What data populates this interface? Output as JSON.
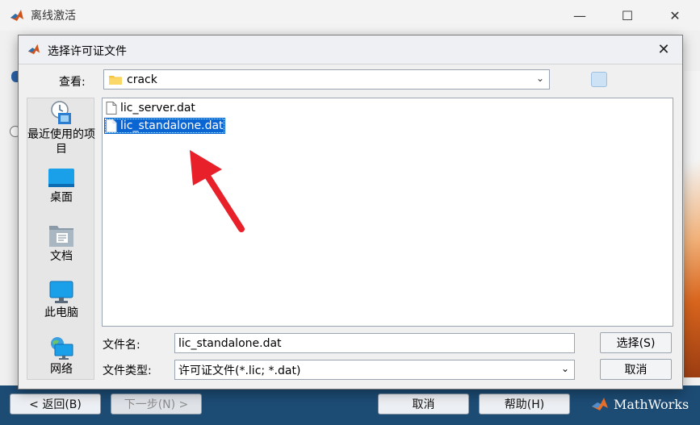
{
  "background_window": {
    "title": "离线激活",
    "controls": [
      "—",
      "☐",
      "✕"
    ],
    "footer": {
      "back_label": "< 返回(B)",
      "next_label": "下一步(N) >",
      "cancel_label": "取消",
      "help_label": "帮助(H)",
      "brand": "MathWorks"
    }
  },
  "dialog": {
    "title": "选择许可证文件",
    "close": "✕",
    "look_in_label": "查看:",
    "look_in_value": "crack",
    "places": [
      {
        "label": "最近使用的项目",
        "icon": "recent-items-icon"
      },
      {
        "label": "桌面",
        "icon": "desktop-icon"
      },
      {
        "label": "文档",
        "icon": "documents-icon"
      },
      {
        "label": "此电脑",
        "icon": "computer-icon"
      },
      {
        "label": "网络",
        "icon": "network-icon"
      }
    ],
    "files": [
      {
        "name": "lic_server.dat",
        "selected": false
      },
      {
        "name": "lic_standalone.dat",
        "selected": true
      }
    ],
    "filename_label": "文件名:",
    "filename_value": "lic_standalone.dat",
    "filetype_label": "文件类型:",
    "filetype_value": "许可证文件(*.lic; *.dat)",
    "select_button": "选择(S)",
    "cancel_button": "取消"
  },
  "colors": {
    "footer_bg": "#1c4b74",
    "selection": "#0a64d2",
    "annotation_arrow": "#e8202a"
  }
}
